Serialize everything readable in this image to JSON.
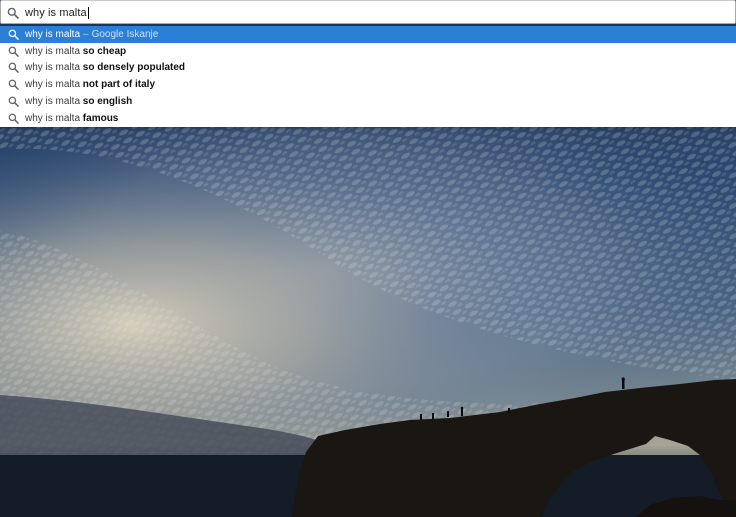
{
  "omnibox": {
    "query": "why is malta",
    "icon": "search-icon"
  },
  "suggestions": [
    {
      "base": "why is malta",
      "bold": "",
      "separator": "–",
      "provider": "Google Iskanje",
      "selected": true
    },
    {
      "base": "why is malta",
      "bold": "so cheap",
      "separator": "",
      "provider": "",
      "selected": false
    },
    {
      "base": "why is malta",
      "bold": "so densely populated",
      "separator": "",
      "provider": "",
      "selected": false
    },
    {
      "base": "why is malta",
      "bold": "not part of italy",
      "separator": "",
      "provider": "",
      "selected": false
    },
    {
      "base": "why is malta",
      "bold": "so english",
      "separator": "",
      "provider": "",
      "selected": false
    },
    {
      "base": "why is malta",
      "bold": "famous",
      "separator": "",
      "provider": "",
      "selected": false
    }
  ],
  "colors": {
    "selection": "#2b7fd6",
    "sky_top": "#2a3c5f",
    "rock": "#1a1612"
  }
}
